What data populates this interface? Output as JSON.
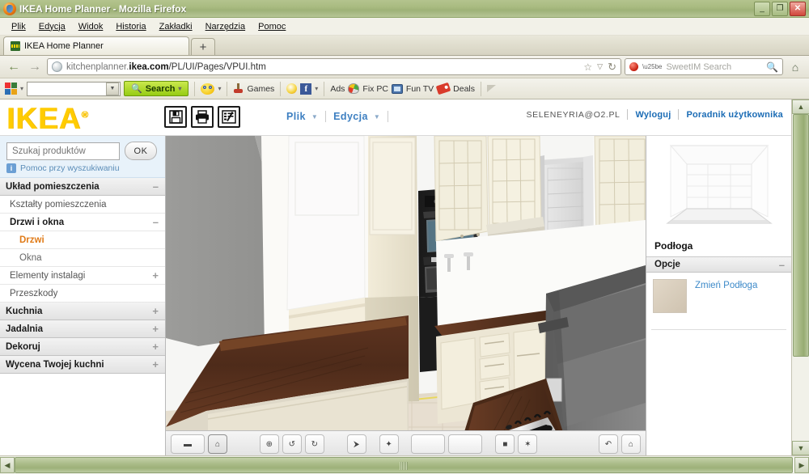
{
  "window": {
    "title": "IKEA Home Planner - Mozilla Firefox",
    "minimize": "_",
    "maximize": "❐",
    "close": "✕"
  },
  "menubar": [
    {
      "label": "Plik"
    },
    {
      "label": "Edycja"
    },
    {
      "label": "Widok"
    },
    {
      "label": "Historia"
    },
    {
      "label": "Zakładki"
    },
    {
      "label": "Narzędzia"
    },
    {
      "label": "Pomoc"
    }
  ],
  "tabs": {
    "active_tab": "IKEA Home Planner",
    "newtab_label": "+"
  },
  "navbar": {
    "back": "←",
    "forward": "→",
    "url_prefix": "kitchenplanner.",
    "url_domain": "ikea.com",
    "url_path": "/PL/UI/Pages/VPUI.htm",
    "url_full": "kitchenplanner.ikea.com/PL/UI/Pages/VPUI.htm",
    "bookmark_icon": "☆",
    "dropdown_icon": "▽",
    "reload_icon": "↻",
    "sweetim_placeholder": "SweetIM Search",
    "search_icon": "🔍",
    "home_icon": "🏠"
  },
  "addonbar": {
    "search_input_value": "",
    "search_button": "Search",
    "games": "Games",
    "ads": "Ads",
    "fixpc": "Fix PC",
    "funtv": "Fun TV",
    "deals": "Deals"
  },
  "app": {
    "logo": "IKEA",
    "logo_mark": "®",
    "tools": [
      {
        "name": "save",
        "glyph": "💾"
      },
      {
        "name": "print",
        "glyph": "🖨"
      },
      {
        "name": "edit-list",
        "glyph": "📝"
      }
    ],
    "menus": [
      {
        "label": "Plik",
        "chevron": "▼"
      },
      {
        "label": "Edycja",
        "chevron": "▼"
      }
    ],
    "account": {
      "email": "SELENEYRIA@O2.PL",
      "logout": "Wyloguj",
      "guide": "Poradnik użytkownika"
    }
  },
  "sidebar_left": {
    "search_placeholder": "Szukaj produktów",
    "search_value": "",
    "ok_button": "OK",
    "help_link": "Pomoc przy wyszukiwaniu",
    "help_icon": "i",
    "tree": [
      {
        "label": "Układ pomieszczenia",
        "type": "category",
        "toggle": "–",
        "children": [
          {
            "label": "Kształty pomieszczenia",
            "type": "item",
            "toggle": ""
          },
          {
            "label": "Drzwi i okna",
            "type": "item-bold",
            "toggle": "–",
            "children": [
              {
                "label": "Drzwi",
                "type": "leaf",
                "selected": true
              },
              {
                "label": "Okna",
                "type": "leaf",
                "selected": false
              }
            ]
          },
          {
            "label": "Elementy instalagi",
            "type": "item",
            "toggle": "+"
          },
          {
            "label": "Przeszkody",
            "type": "item",
            "toggle": ""
          }
        ]
      },
      {
        "label": "Kuchnia",
        "type": "category",
        "toggle": "+"
      },
      {
        "label": "Jadalnia",
        "type": "category",
        "toggle": "+"
      },
      {
        "label": "Dekoruj",
        "type": "category",
        "toggle": "+"
      },
      {
        "label": "Wycena Twojej kuchni",
        "type": "category",
        "toggle": "+"
      }
    ]
  },
  "sidebar_right": {
    "preview_title": "Podłoga",
    "options_header": "Opcje",
    "options_toggle": "–",
    "change_link": "Zmień Podłoga"
  },
  "viewport_toolbar": {
    "buttons": [
      {
        "name": "reset-view",
        "glyph": "▬"
      },
      {
        "name": "home-view",
        "glyph": "⌂"
      },
      {
        "name": "zoom-in",
        "glyph": "⊕"
      },
      {
        "name": "rotate-left",
        "glyph": "↺"
      },
      {
        "name": "rotate-right",
        "glyph": "↻"
      },
      {
        "name": "walk-mode",
        "glyph": "⮞"
      },
      {
        "name": "pan-mode",
        "glyph": "✦"
      },
      {
        "name": "view-2d",
        "glyph": ""
      },
      {
        "name": "view-3d",
        "glyph": ""
      },
      {
        "name": "camera",
        "glyph": "■"
      },
      {
        "name": "light",
        "glyph": "✶"
      },
      {
        "name": "undo",
        "glyph": "↶"
      },
      {
        "name": "delete",
        "glyph": "⌂"
      }
    ]
  },
  "scrollbars": {
    "v_up": "▲",
    "v_down": "▼",
    "h_left": "◀",
    "h_right": "▶"
  }
}
